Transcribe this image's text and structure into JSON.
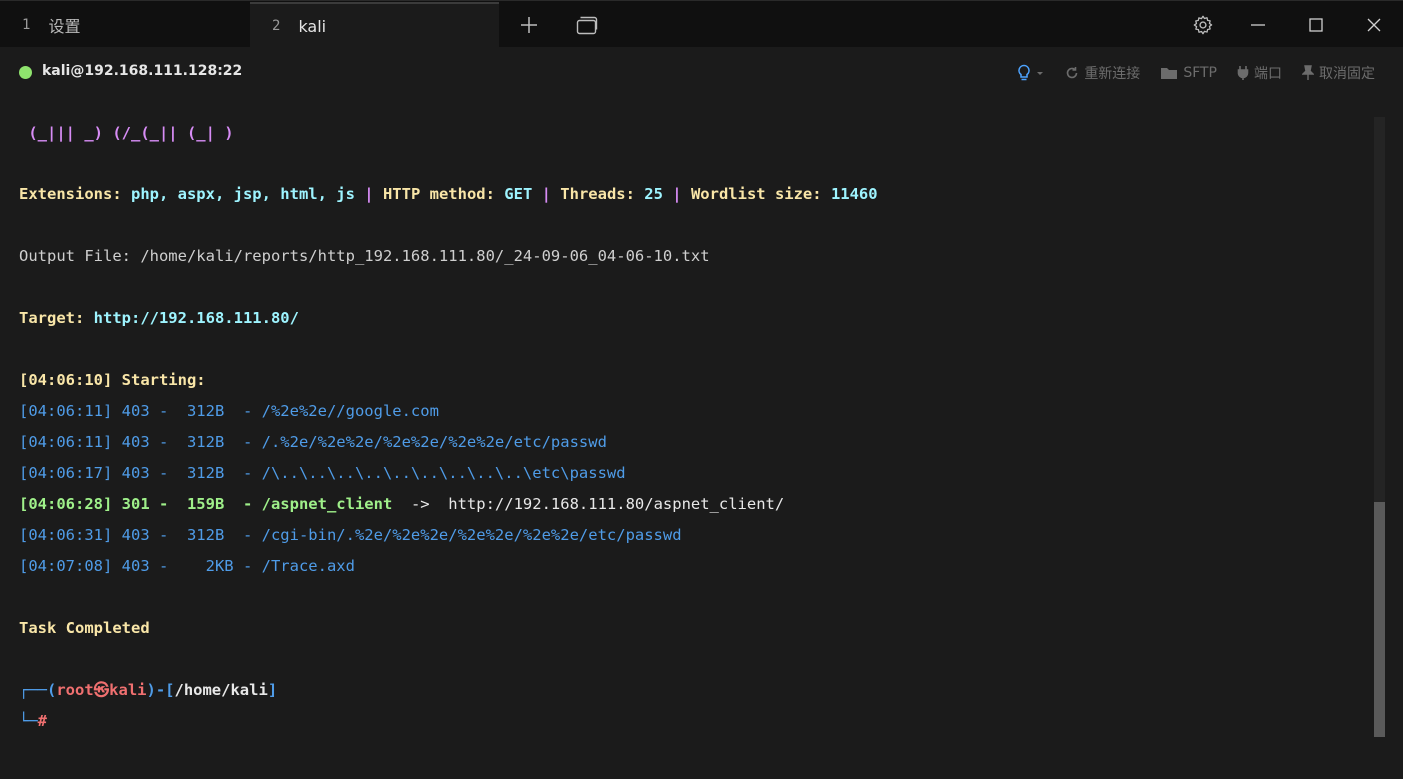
{
  "tabs": [
    {
      "num": "1",
      "label": "设置"
    },
    {
      "num": "2",
      "label": "kali"
    }
  ],
  "connection": {
    "host": "kali@192.168.111.128:22",
    "status_color": "#8fe36e",
    "actions": {
      "reconnect": "重新连接",
      "sftp": "SFTP",
      "port": "端口",
      "unpin": "取消固定"
    }
  },
  "terminal": {
    "banner": " (_||| _) (/_(_|| (_| )",
    "ext_label": "Extensions: ",
    "ext_value": "php, aspx, jsp, html, js",
    "sep": " | ",
    "method_label": "HTTP method: ",
    "method_value": "GET",
    "threads_label": "Threads: ",
    "threads_value": "25",
    "wordlist_label": "Wordlist size: ",
    "wordlist_value": "11460",
    "output_file": "Output File: /home/kali/reports/http_192.168.111.80/_24-09-06_04-06-10.txt",
    "target_label": "Target: ",
    "target_value": "http://192.168.111.80/",
    "starting": "[04:06:10] Starting:",
    "results": [
      {
        "text": "[04:06:11] 403 -  312B  - /%2e%2e//google.com",
        "style": "blue"
      },
      {
        "text": "[04:06:11] 403 -  312B  - /.%2e/%2e%2e/%2e%2e/%2e%2e/etc/passwd",
        "style": "blue"
      },
      {
        "text": "[04:06:17] 403 -  312B  - /\\..\\..\\..\\..\\..\\..\\..\\..\\..\\etc\\passwd",
        "style": "blue"
      },
      {
        "text": "[04:06:28] 301 -  159B  - /aspnet_client",
        "redirect": "  ->  http://192.168.111.80/aspnet_client/",
        "style": "green"
      },
      {
        "text": "[04:06:31] 403 -  312B  - /cgi-bin/.%2e/%2e%2e/%2e%2e/%2e%2e/etc/passwd",
        "style": "blue"
      },
      {
        "text": "[04:07:08] 403 -    2KB - /Trace.axd",
        "style": "blue"
      }
    ],
    "task_completed": "Task Completed",
    "prompt": {
      "corner_top": "┌──(",
      "user": "root㉿kali",
      "mid": ")-[",
      "path": "/home/kali",
      "end": "]",
      "corner_bottom": "└─",
      "hash": "#"
    }
  }
}
